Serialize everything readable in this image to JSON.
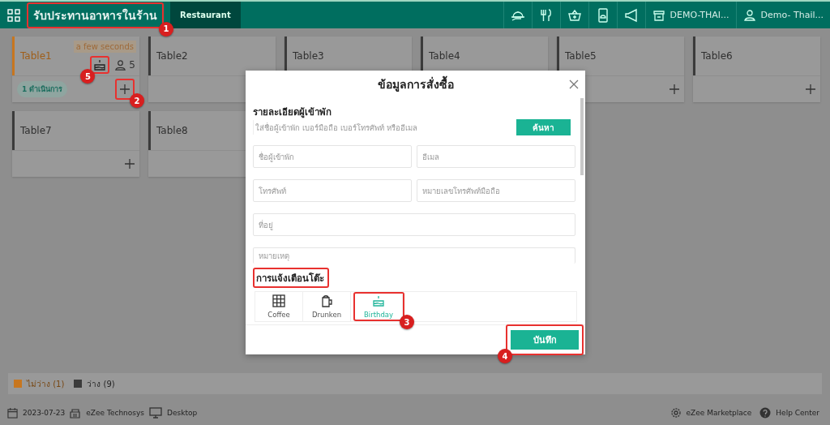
{
  "topbar": {
    "title": "รับประทานอาหารในร้าน",
    "title_callout": "1",
    "tab": {
      "label": "Restaurant",
      "selected": true
    },
    "property": "DEMO-THAI...",
    "user": "Demo- Thail..."
  },
  "tables": [
    {
      "name": "Table1",
      "color": "#c7761f",
      "time": "a few seconds",
      "birthday": true,
      "guests": "5",
      "orders": "1 ดำเนินการ",
      "add_callout": "2",
      "icon_callout": "5"
    },
    {
      "name": "Table2",
      "color": "#3b3b3b"
    },
    {
      "name": "Table3",
      "color": "#3b3b3b"
    },
    {
      "name": "Table4",
      "color": "#3b3b3b"
    },
    {
      "name": "Table5",
      "color": "#3b3b3b"
    },
    {
      "name": "Table6",
      "color": "#3b3b3b"
    },
    {
      "name": "Table7",
      "color": "#3b3b3b"
    },
    {
      "name": "Table8",
      "color": "#3b3b3b"
    }
  ],
  "legend": [
    {
      "label": "ไม่ว่าง (1)",
      "color": "#c7761f"
    },
    {
      "label": "ว่าง (9)",
      "color": "#3b3b3b"
    }
  ],
  "status_bar": {
    "date": "2023-07-23",
    "company": "eZee Technosys",
    "device": "Desktop",
    "marketplace": "eZee Marketplace",
    "help": "Help Center"
  },
  "modal": {
    "title": "ข้อมูลการสั่งซื้อ",
    "section": "รายละเอียดผู้เข้าพัก",
    "search_placeholder": "ใส่ชื่อผู้เข้าพัก เบอร์มือถือ เบอร์โทรศัพท์ หรืออีเมล",
    "search_button": "ค้นหา",
    "fields": [
      {
        "placeholder": "ชื่อผู้เข้าพัก",
        "wide": false
      },
      {
        "placeholder": "อีเมล",
        "wide": false
      },
      {
        "placeholder": "โทรศัพท์",
        "wide": false
      },
      {
        "placeholder": "หมายเลขโทรศัพท์มือถือ",
        "wide": false
      },
      {
        "placeholder": "ที่อยู่",
        "wide": true
      },
      {
        "placeholder": "หมายเหตุ",
        "wide": true
      }
    ],
    "alerts_heading": "การแจ้งเตือนโต๊ะ",
    "alerts_highlighted": true,
    "alerts": [
      {
        "label": "Coffee",
        "kind": "grid",
        "selected": false
      },
      {
        "label": "Drunken",
        "kind": "mug",
        "selected": false
      },
      {
        "label": "Birthday",
        "kind": "cake",
        "selected": true,
        "callout": "3"
      }
    ],
    "save": "บันทึก",
    "save_callout": "4"
  }
}
